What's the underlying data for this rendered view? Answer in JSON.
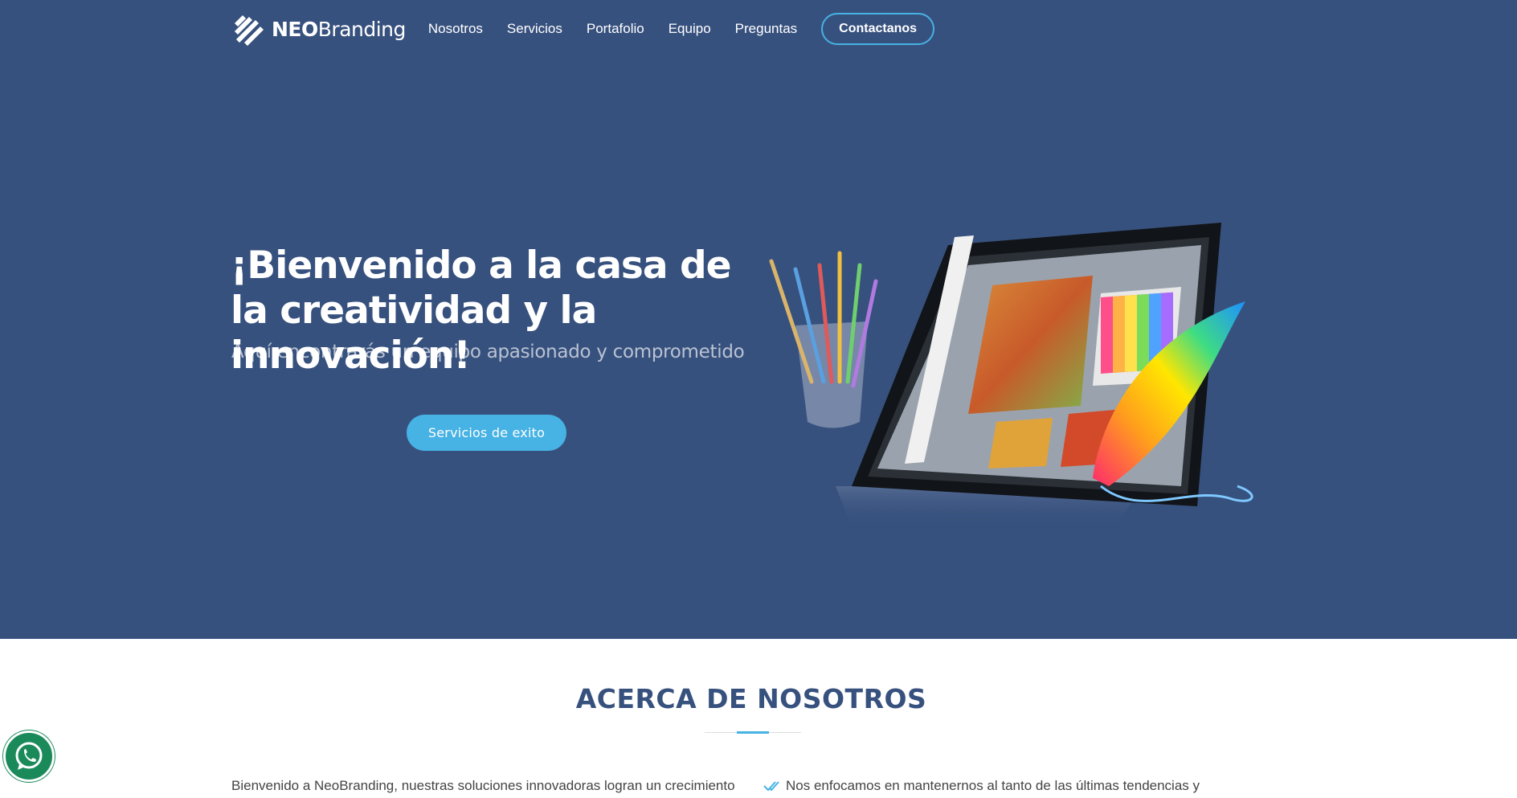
{
  "header": {
    "logo_strong": "NEO",
    "logo_light": "Branding",
    "nav": [
      "Nosotros",
      "Servicios",
      "Portafolio",
      "Equipo",
      "Preguntas"
    ],
    "contact_label": "Contactanos"
  },
  "hero": {
    "title": "¡Bienvenido a la casa de la creatividad y la innovación!",
    "subtitle": "Aquí encontrarás un equipo apasionado y comprometido",
    "cta_label": "Servicios de exito"
  },
  "about": {
    "title": "ACERCA DE NOSOTROS",
    "left_text": "Bienvenido a NeoBranding, nuestras soluciones innovadoras logran un crecimiento",
    "right_text": "Nos enfocamos en mantenernos al tanto de las últimas tendencias y"
  },
  "colors": {
    "hero_bg": "#37517e",
    "accent": "#47b2e4",
    "whatsapp": "#1b8a5a"
  },
  "icons": {
    "logo": "neobranding-logo-icon",
    "check": "double-check-icon",
    "whatsapp": "whatsapp-icon"
  }
}
